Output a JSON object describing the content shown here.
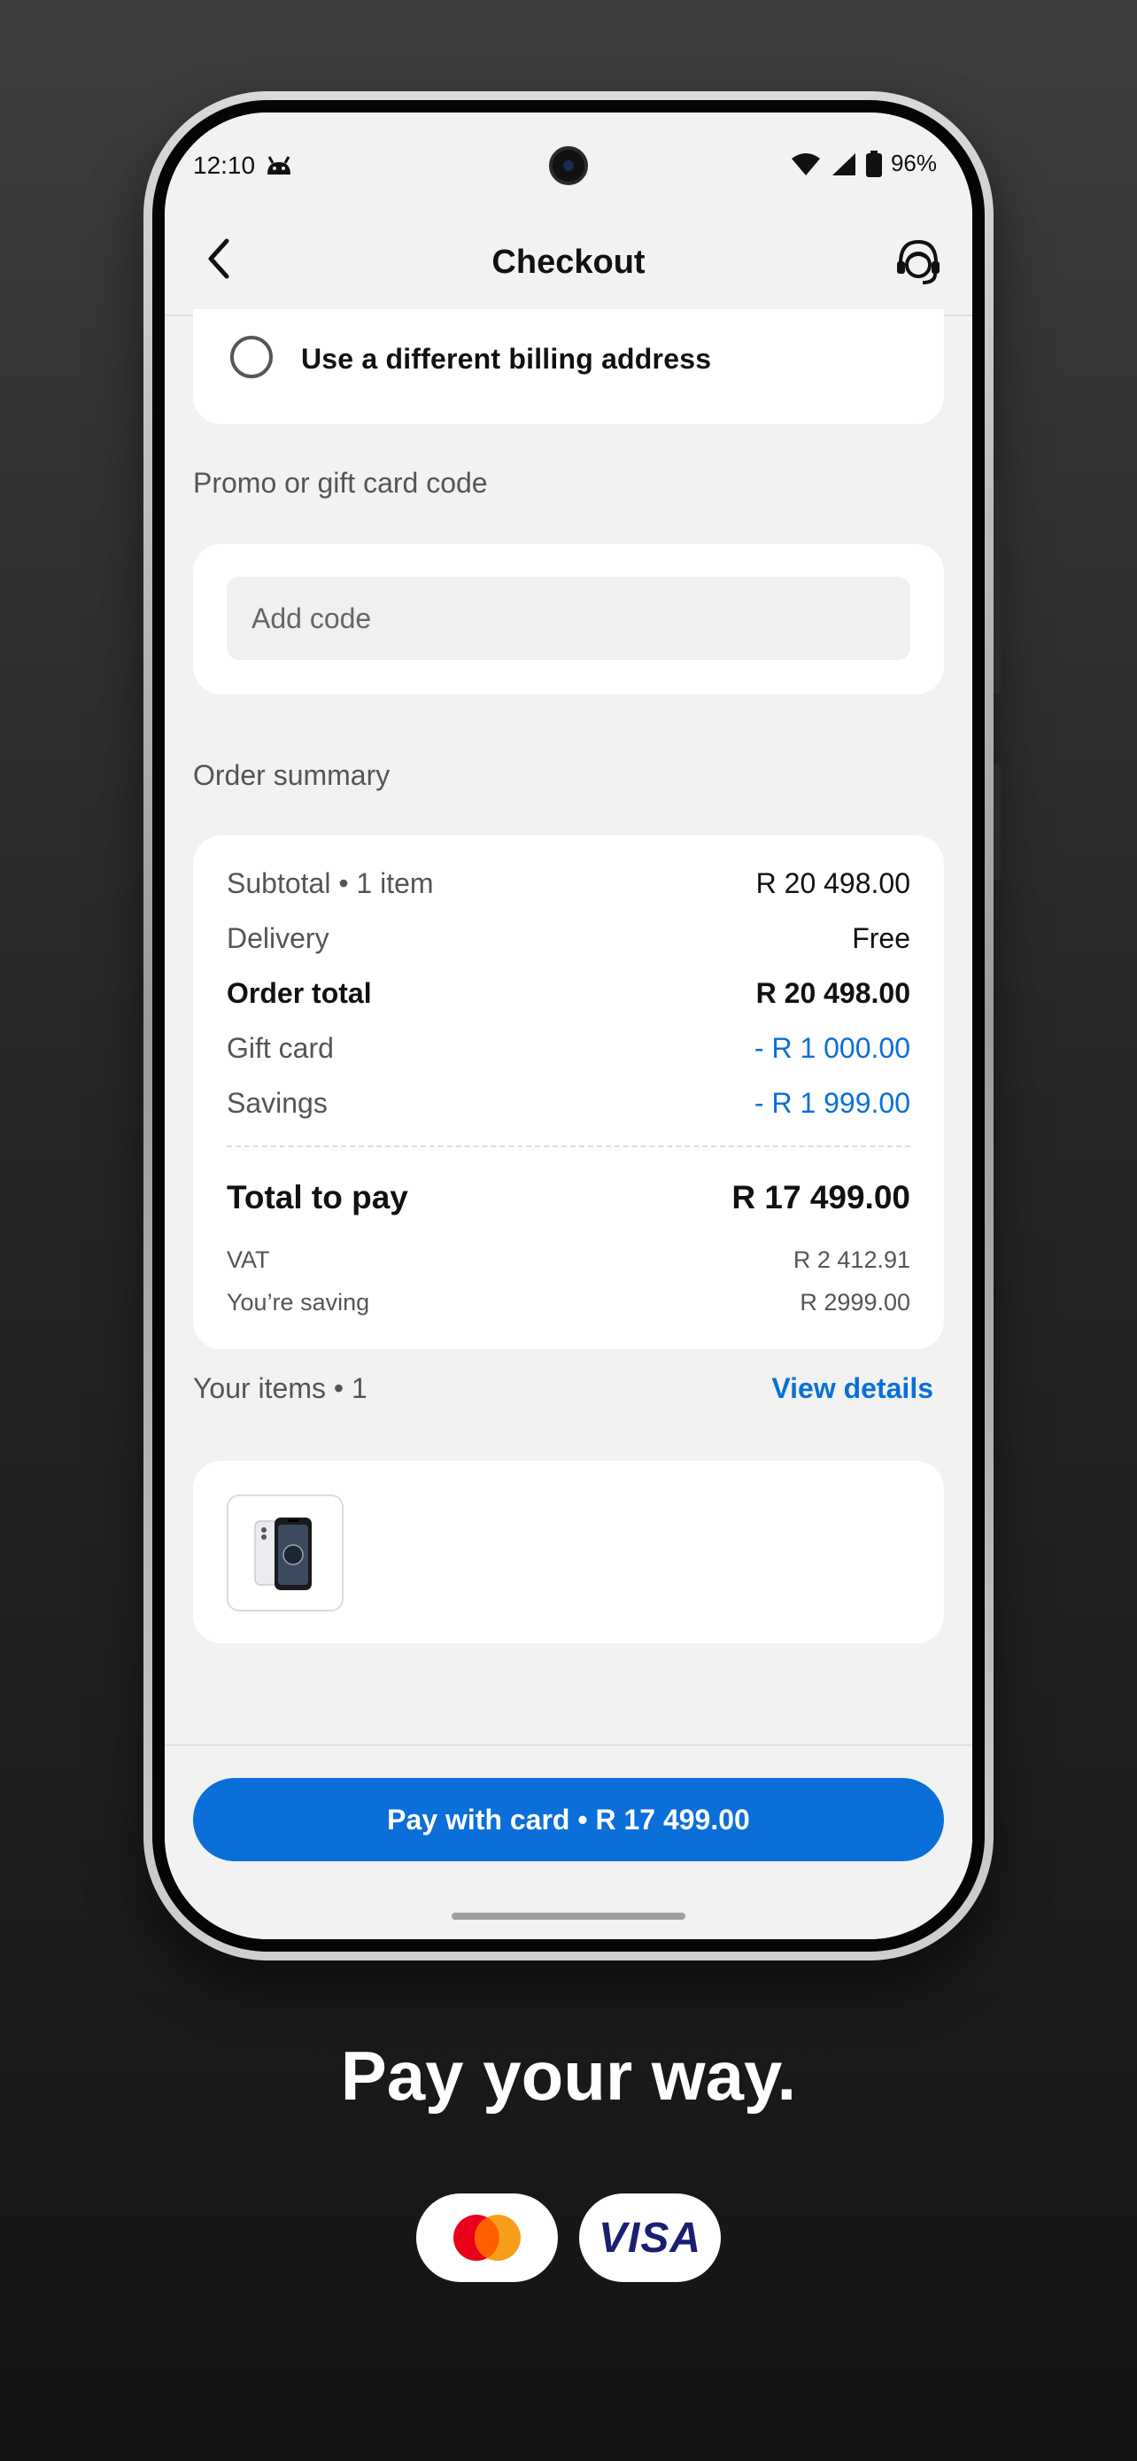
{
  "status_bar": {
    "time": "12:10",
    "battery": "96%"
  },
  "header": {
    "title": "Checkout"
  },
  "billing": {
    "label": "Use a different billing address"
  },
  "promo": {
    "section_label": "Promo or gift card code",
    "placeholder": "Add code"
  },
  "summary": {
    "section_label": "Order summary",
    "subtotal_label": "Subtotal • 1 item",
    "subtotal_value": "R 20 498.00",
    "delivery_label": "Delivery",
    "delivery_value": "Free",
    "order_total_label": "Order total",
    "order_total_value": "R 20 498.00",
    "gift_card_label": "Gift card",
    "gift_card_value": "- R 1 000.00",
    "savings_label": "Savings",
    "savings_value": "- R 1 999.00",
    "total_label": "Total to pay",
    "total_value": "R 17 499.00",
    "vat_label": "VAT",
    "vat_value": "R 2 412.91",
    "saving_label": "You’re saving",
    "saving_value": "R 2999.00"
  },
  "items": {
    "label": "Your items • 1",
    "view_details": "View details"
  },
  "pay_button": "Pay with card • R 17 499.00",
  "tagline": "Pay your way.",
  "payment_logos": {
    "visa": "VISA"
  },
  "colors": {
    "accent": "#0a6fd8",
    "discount": "#0a6fd8"
  }
}
